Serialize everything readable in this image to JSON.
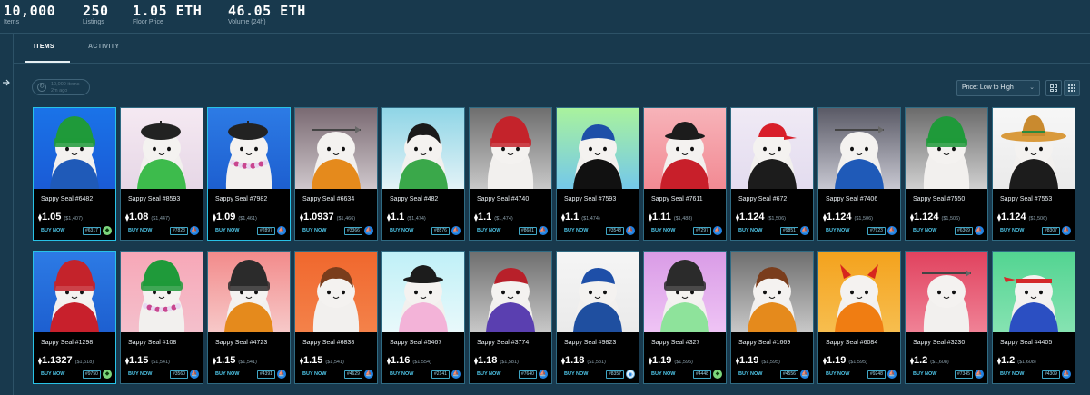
{
  "stats": [
    {
      "value": "10,000",
      "label": "Items"
    },
    {
      "value": "250",
      "label": "Listings"
    },
    {
      "value": "1.05 ETH",
      "label": "Floor Price"
    },
    {
      "value": "46.05 ETH",
      "label": "Volume (24h)"
    }
  ],
  "nav": {
    "collapse_icon": "arrow-right-icon"
  },
  "tabs": [
    {
      "label": "ITEMS",
      "active": true
    },
    {
      "label": "ACTIVITY",
      "active": false
    }
  ],
  "refresh": {
    "line1": "10,000 items",
    "line2": "2m ago",
    "icon": "refresh-icon"
  },
  "sort": {
    "selected": "Price: Low to High",
    "icon": "chevron-down-icon"
  },
  "view_toggles": [
    {
      "icon": "grid-large-icon"
    },
    {
      "icon": "grid-small-icon"
    }
  ],
  "colors": {
    "background": "#18394d",
    "accent": "#4fc7ea",
    "card": "#000000"
  },
  "items": [
    {
      "name": "Sappy Seal #6482",
      "price": "1.05",
      "usd": "($1,407)",
      "buy": "BUY NOW",
      "rank": "#6317",
      "market": "looksrare-icon",
      "bg": [
        "#1a73e8",
        "#1a5bd6"
      ],
      "hat": "beanie-green",
      "outfit": "hoodie-blue",
      "highlight": true
    },
    {
      "name": "Sappy Seal #8593",
      "price": "1.08",
      "usd": "($1,447)",
      "buy": "BUY NOW",
      "rank": "#7823",
      "market": "opensea-icon",
      "bg": [
        "#f5e9f2",
        "#e6d7e6"
      ],
      "hat": "beret-black",
      "outfit": "tee-green",
      "highlight": false
    },
    {
      "name": "Sappy Seal #7982",
      "price": "1.09",
      "usd": "($1,461)",
      "buy": "BUY NOW",
      "rank": "#2897",
      "market": "opensea-icon",
      "bg": [
        "#2d7be5",
        "#1d5fd0"
      ],
      "hat": "beret-black",
      "outfit": "lei",
      "highlight": true
    },
    {
      "name": "Sappy Seal #6634",
      "price": "1.0937",
      "usd": "($1,466)",
      "buy": "BUY NOW",
      "rank": "#3366",
      "market": "opensea-icon",
      "bg": [
        "#7a6a72",
        "#cfc7cc"
      ],
      "hat": "arrow",
      "outfit": "sweater-orange",
      "highlight": false
    },
    {
      "name": "Sappy Seal #482",
      "price": "1.1",
      "usd": "($1,474)",
      "buy": "BUY NOW",
      "rank": "#8576",
      "market": "opensea-icon",
      "bg": [
        "#8fd5e6",
        "#e3f3f7"
      ],
      "hat": "hair-black",
      "outfit": "scarf-green",
      "highlight": false
    },
    {
      "name": "Sappy Seal #4740",
      "price": "1.1",
      "usd": "($1,474)",
      "buy": "BUY NOW",
      "rank": "#8681",
      "market": "opensea-icon",
      "bg": [
        "#6e6e6e",
        "#c8c8c8"
      ],
      "hat": "beanie-red",
      "outfit": "none",
      "highlight": false
    },
    {
      "name": "Sappy Seal #7593",
      "price": "1.1",
      "usd": "($1,474)",
      "buy": "BUY NOW",
      "rank": "#3548",
      "market": "opensea-icon",
      "bg": [
        "#a9f29d",
        "#74c8ea"
      ],
      "hat": "bandana-blue",
      "outfit": "jacket-black",
      "highlight": false
    },
    {
      "name": "Sappy Seal #7611",
      "price": "1.11",
      "usd": "($1,488)",
      "buy": "BUY NOW",
      "rank": "#7297",
      "market": "opensea-icon",
      "bg": [
        "#f7b3b9",
        "#f28a93"
      ],
      "hat": "bucket-black",
      "outfit": "coat-red",
      "highlight": false
    },
    {
      "name": "Sappy Seal #672",
      "price": "1.124",
      "usd": "($1,506)",
      "buy": "BUY NOW",
      "rank": "#9851",
      "market": "opensea-icon",
      "bg": [
        "#f0eaf5",
        "#e3dcef"
      ],
      "hat": "cap-red",
      "outfit": "tee-black",
      "highlight": false
    },
    {
      "name": "Sappy Seal #7406",
      "price": "1.124",
      "usd": "($1,506)",
      "buy": "BUY NOW",
      "rank": "#7923",
      "market": "opensea-icon",
      "bg": [
        "#5a5a66",
        "#c8c8d2"
      ],
      "hat": "arrow",
      "outfit": "hoodie-blue",
      "highlight": false
    },
    {
      "name": "Sappy Seal #7550",
      "price": "1.124",
      "usd": "($1,506)",
      "buy": "BUY NOW",
      "rank": "#6369",
      "market": "opensea-icon",
      "bg": [
        "#6b6b6b",
        "#d0d0d0"
      ],
      "hat": "beanie-green",
      "outfit": "none",
      "highlight": false
    },
    {
      "name": "Sappy Seal #7553",
      "price": "1.124",
      "usd": "($1,506)",
      "buy": "BUY NOW",
      "rank": "#8307",
      "market": "opensea-icon",
      "bg": [
        "#f7f7f7",
        "#eaeaea"
      ],
      "hat": "sombrero",
      "outfit": "tee-black",
      "highlight": false
    },
    {
      "name": "Sappy Seal #1298",
      "price": "1.1327",
      "usd": "($1,518)",
      "buy": "BUY NOW",
      "rank": "#9750",
      "market": "looksrare-icon",
      "bg": [
        "#2d7be5",
        "#1d5fd0"
      ],
      "hat": "beanie-red",
      "outfit": "hoodie-red",
      "highlight": true
    },
    {
      "name": "Sappy Seal #108",
      "price": "1.15",
      "usd": "($1,541)",
      "buy": "BUY NOW",
      "rank": "#3560",
      "market": "opensea-icon",
      "bg": [
        "#f7a7b7",
        "#f4c0cc"
      ],
      "hat": "beanie-green",
      "outfit": "lei",
      "highlight": false
    },
    {
      "name": "Sappy Seal #4723",
      "price": "1.15",
      "usd": "($1,541)",
      "buy": "BUY NOW",
      "rank": "#4391",
      "market": "opensea-icon",
      "bg": [
        "#f28a8a",
        "#f7c9c9"
      ],
      "hat": "beanie-black",
      "outfit": "sweater-orange",
      "highlight": false
    },
    {
      "name": "Sappy Seal #6838",
      "price": "1.15",
      "usd": "($1,541)",
      "buy": "BUY NOW",
      "rank": "#4629",
      "market": "opensea-icon",
      "bg": [
        "#f0672d",
        "#f4824a"
      ],
      "hat": "hair-brown",
      "outfit": "none",
      "highlight": false
    },
    {
      "name": "Sappy Seal #5467",
      "price": "1.16",
      "usd": "($1,554)",
      "buy": "BUY NOW",
      "rank": "#2141",
      "market": "opensea-icon",
      "bg": [
        "#bff0f7",
        "#e9f9fb"
      ],
      "hat": "bucket-black",
      "outfit": "kimono-pink",
      "highlight": false
    },
    {
      "name": "Sappy Seal #3774",
      "price": "1.18",
      "usd": "($1,581)",
      "buy": "BUY NOW",
      "rank": "#7640",
      "market": "opensea-icon",
      "bg": [
        "#6e6e6e",
        "#c8c8c8"
      ],
      "hat": "bandana-red",
      "outfit": "hoodie-purple",
      "highlight": false
    },
    {
      "name": "Sappy Seal #9823",
      "price": "1.18",
      "usd": "($1,581)",
      "buy": "BUY NOW",
      "rank": "#8357",
      "market": "wallet-icon",
      "bg": [
        "#f5f5f5",
        "#eaeaea"
      ],
      "hat": "bandana-blue",
      "outfit": "jacket-blue",
      "highlight": false
    },
    {
      "name": "Sappy Seal #327",
      "price": "1.19",
      "usd": "($1,595)",
      "buy": "BUY NOW",
      "rank": "#4448",
      "market": "looksrare-icon",
      "bg": [
        "#d99be6",
        "#efc4f5"
      ],
      "hat": "beanie-black",
      "outfit": "kimono-green",
      "highlight": false
    },
    {
      "name": "Sappy Seal #1669",
      "price": "1.19",
      "usd": "($1,595)",
      "buy": "BUY NOW",
      "rank": "#4556",
      "market": "opensea-icon",
      "bg": [
        "#6e6e6e",
        "#c8c8c8"
      ],
      "hat": "hair-brown",
      "outfit": "sweater-orange",
      "highlight": false
    },
    {
      "name": "Sappy Seal #6084",
      "price": "1.19",
      "usd": "($1,595)",
      "buy": "BUY NOW",
      "rank": "#9248",
      "market": "opensea-icon",
      "bg": [
        "#f4a21d",
        "#f7be4f"
      ],
      "hat": "devil",
      "outfit": "tee-orange",
      "highlight": false
    },
    {
      "name": "Sappy Seal #3230",
      "price": "1.2",
      "usd": "($1,608)",
      "buy": "BUY NOW",
      "rank": "#7345",
      "market": "opensea-icon",
      "bg": [
        "#e0425e",
        "#f08296"
      ],
      "hat": "arrow",
      "outfit": "none",
      "highlight": false
    },
    {
      "name": "Sappy Seal #4405",
      "price": "1.2",
      "usd": "($1,608)",
      "buy": "BUY NOW",
      "rank": "#4309",
      "market": "opensea-icon",
      "bg": [
        "#52d491",
        "#86e3b2"
      ],
      "hat": "headband-red",
      "outfit": "tee-blue",
      "highlight": false
    }
  ]
}
